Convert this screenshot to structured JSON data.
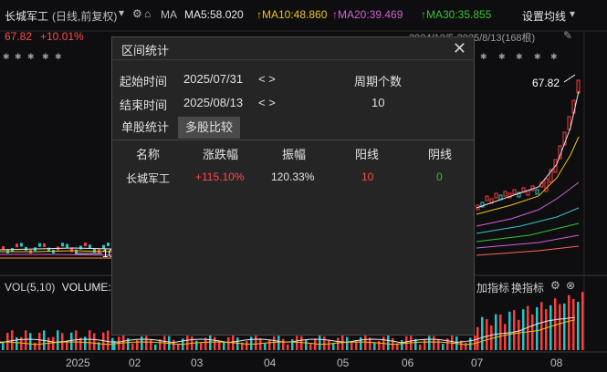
{
  "header": {
    "stock_name": "长城军工",
    "period_mode": "(日线,前复权)",
    "ma_label": "MA",
    "ma5": "MA5:58.020",
    "ma10": "↑MA10:48.860",
    "ma20": "↑MA20:39.469",
    "ma30": "↑MA30:35.855",
    "settings_label": "设置均线",
    "price": "67.82",
    "change": "+10.01%",
    "range_info": "2024/12/5-2025/8/13(168根)",
    "high_marker": "67.82",
    "low_marker": "10"
  },
  "colors": {
    "ma5": "#e8e8e8",
    "ma10": "#f0c419",
    "ma20": "#d25fd2",
    "ma30": "#37c437",
    "up": "#ff3b3b",
    "down": "#22c6c6"
  },
  "dialog": {
    "title": "区间统计",
    "start_label": "起始时间",
    "start_value": "2025/07/31",
    "end_label": "结束时间",
    "end_value": "2025/08/13",
    "arrows": "< >",
    "period_count_label": "周期个数",
    "period_count_value": "10",
    "tabs": [
      "单股统计",
      "多股比较"
    ],
    "active_tab": "多股比较",
    "columns": [
      "名称",
      "涨跌幅",
      "振幅",
      "阳线",
      "阴线"
    ],
    "rows": [
      {
        "name": "长城军工",
        "change": "+115.10%",
        "amplitude": "120.33%",
        "up_days": "10",
        "down_days": "0"
      }
    ]
  },
  "volume": {
    "label": "VOL(5,10)",
    "label2": "VOLUME:",
    "add_indicator": "加指标",
    "switch_indicator": "换指标"
  },
  "x_axis": [
    "2025",
    "02",
    "03",
    "04",
    "05",
    "06",
    "07",
    "08"
  ]
}
